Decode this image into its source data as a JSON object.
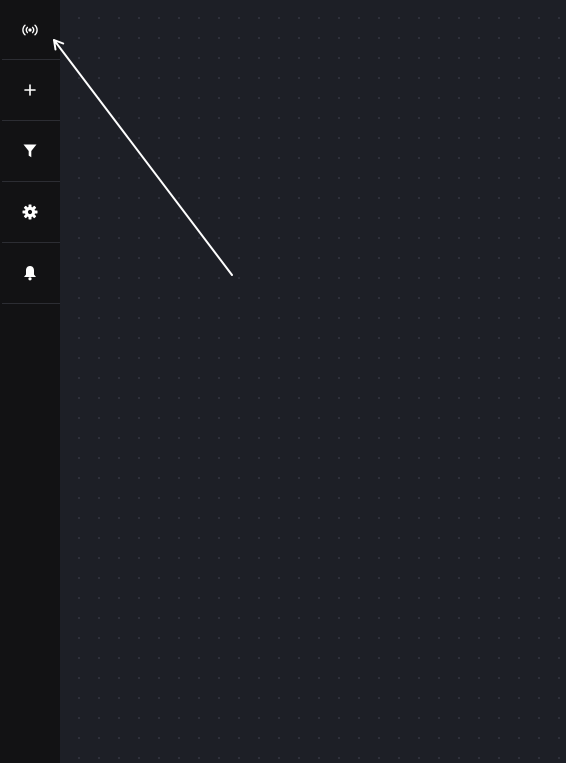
{
  "sidebar": {
    "buttons": [
      {
        "id": "broadcast",
        "icon": "broadcast-icon"
      },
      {
        "id": "add",
        "icon": "plus-icon"
      },
      {
        "id": "filter",
        "icon": "filter-icon"
      },
      {
        "id": "settings",
        "icon": "gear-icon"
      },
      {
        "id": "notifications",
        "icon": "bell-icon"
      }
    ]
  },
  "colors": {
    "sidebar_bg": "#121214",
    "canvas_bg": "#1d1f26",
    "icon": "#ffffff",
    "divider": "#2c2d33",
    "grid_dot": "#2f323c"
  },
  "canvas": {
    "has_arrow": true,
    "arrow_color": "#ffffff"
  }
}
